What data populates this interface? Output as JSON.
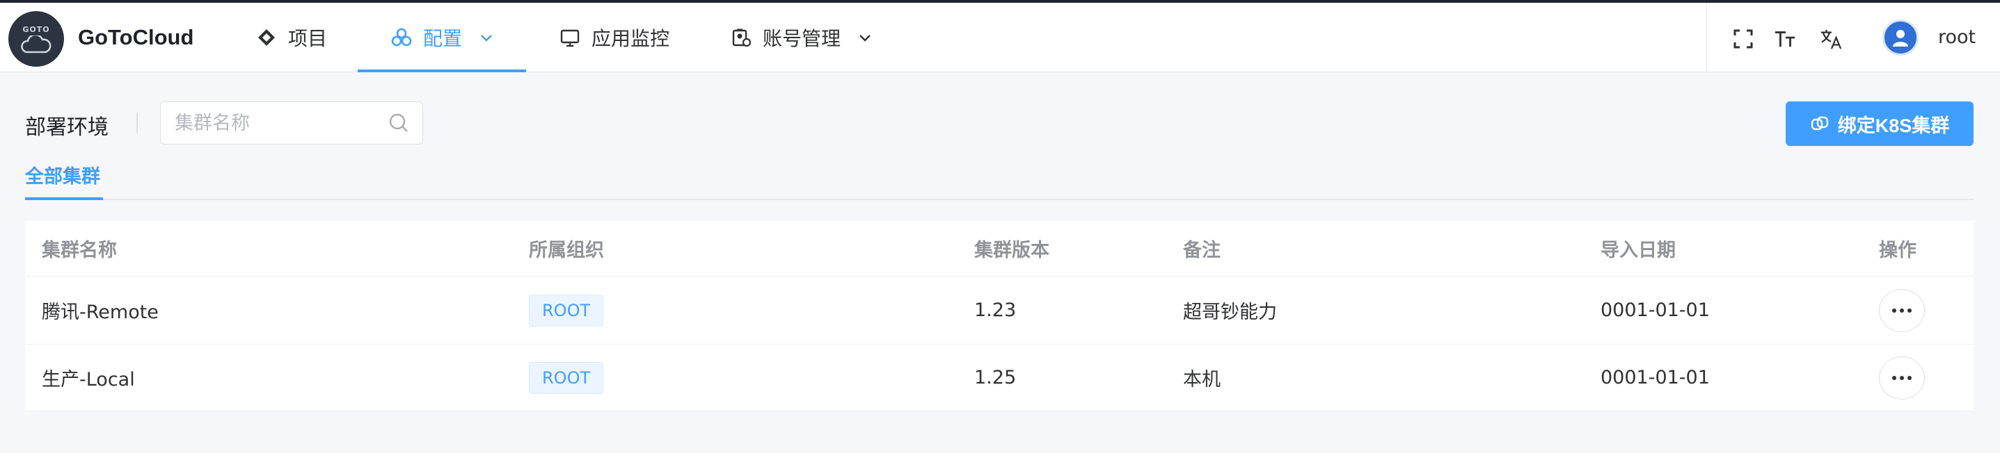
{
  "app": {
    "logo_text": "GOTO",
    "brand": "GoToCloud"
  },
  "nav": {
    "items": [
      {
        "label": "项目",
        "icon": "diamond-icon"
      },
      {
        "label": "配置",
        "icon": "layers-icon",
        "active": true
      },
      {
        "label": "应用监控",
        "icon": "monitor-icon"
      },
      {
        "label": "账号管理",
        "icon": "account-icon"
      }
    ]
  },
  "header": {
    "username": "root",
    "fullscreen_icon": "fullscreen-icon",
    "font_size_icon": "font-size-icon",
    "translate_icon": "translate-icon"
  },
  "toolbar": {
    "title": "部署环境",
    "search_placeholder": "集群名称",
    "bind_button": "绑定K8S集群"
  },
  "tabs": [
    {
      "label": "全部集群",
      "active": true
    }
  ],
  "table": {
    "columns": [
      "集群名称",
      "所属组织",
      "集群版本",
      "备注",
      "导入日期",
      "操作"
    ],
    "rows": [
      {
        "name": "腾讯-Remote",
        "org": "ROOT",
        "version": "1.23",
        "note": "超哥钞能力",
        "date": "0001-01-01"
      },
      {
        "name": "生产-Local",
        "org": "ROOT",
        "version": "1.25",
        "note": "本机",
        "date": "0001-01-01"
      }
    ]
  },
  "colors": {
    "accent": "#409eff",
    "header_bg": "#ffffff",
    "page_bg": "#f5f7fa"
  }
}
